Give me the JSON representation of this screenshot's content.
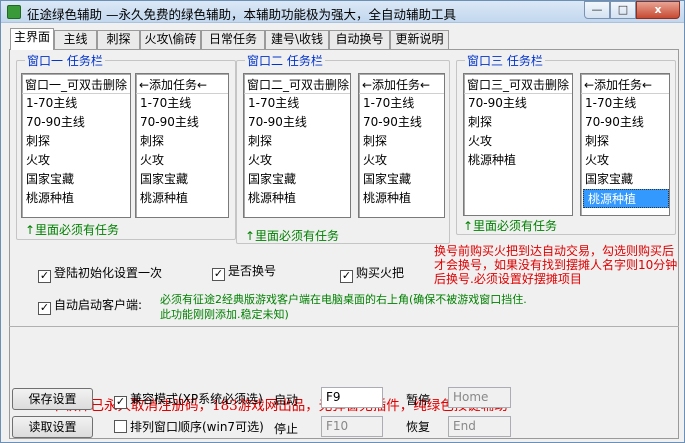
{
  "window": {
    "title": "征途绿色辅助 —永久免费的绿色辅助，本辅助功能极为强大，全自动辅助工具",
    "min": "—",
    "max": "□",
    "close": "x"
  },
  "tabs": [
    "主界面",
    "主线",
    "刺探",
    "火攻\\偷砖",
    "日常任务",
    "建号\\收钱",
    "自动换号",
    "更新说明"
  ],
  "groups": [
    {
      "legend": "窗口一   任务栏",
      "left_head": "窗口一_可双击删除",
      "left_items": [
        "1-70主线",
        "70-90主线",
        "刺探",
        "火攻",
        "国家宝藏",
        "桃源种植"
      ],
      "right_head": "←添加任务←",
      "right_items": [
        "1-70主线",
        "70-90主线",
        "刺探",
        "火攻",
        "国家宝藏",
        "桃源种植"
      ],
      "note": "↑里面必须有任务"
    },
    {
      "legend": "窗口二   任务栏",
      "left_head": "窗口二_可双击删除",
      "left_items": [
        "1-70主线",
        "70-90主线",
        "刺探",
        "火攻",
        "国家宝藏",
        "桃源种植"
      ],
      "right_head": "←添加任务←",
      "right_items": [
        "1-70主线",
        "70-90主线",
        "刺探",
        "火攻",
        "国家宝藏",
        "桃源种植"
      ],
      "note": "↑里面必须有任务"
    },
    {
      "legend": "窗口三   任务栏",
      "left_head": "窗口三_可双击删除",
      "left_items": [
        "70-90主线",
        "刺探",
        "火攻",
        "桃源种植"
      ],
      "right_head": "←添加任务←",
      "right_items": [
        "1-70主线",
        "70-90主线",
        "刺探",
        "火攻",
        "国家宝藏",
        "桃源种植"
      ],
      "selected_right": "桃源种植",
      "note": "↑里面必须有任务"
    }
  ],
  "options": {
    "init_once": {
      "label": "登陆初始化设置一次",
      "checked": true
    },
    "switch_account": {
      "label": "是否换号",
      "checked": true
    },
    "buy_torch": {
      "label": "购买火把",
      "checked": true
    },
    "auto_start": {
      "label": "自动启动客户端:",
      "checked": true
    }
  },
  "notes": {
    "red": [
      "换号前购买火把到达自动交易，勾选则购买后",
      "才会换号，如果没有找到摆摊人名字则10分钟",
      "后换号.必须设置好摆摊项目"
    ],
    "green": [
      "必须有征途2经典版游戏客户端在电脑桌面的右上角(确保不被游戏窗口挡住.",
      "此功能刚刚添加.稳定未知)"
    ]
  },
  "banner": "本软件已永久取消注册码，183游戏网出品，无弹窗无插件，纯绿色按键辅助",
  "bottom": {
    "save": "保存设置",
    "load": "读取设置",
    "compat": {
      "label": "兼容模式(XP系统必须选)",
      "checked": true
    },
    "arrange": {
      "label": "排列窗口顺序(win7可选)",
      "checked": false
    },
    "start_label": "启动",
    "start_key": "F9",
    "pause_label": "暂停",
    "pause_key": "Home",
    "stop_label": "停止",
    "stop_key": "F10",
    "resume_label": "恢复",
    "resume_key": "End"
  }
}
